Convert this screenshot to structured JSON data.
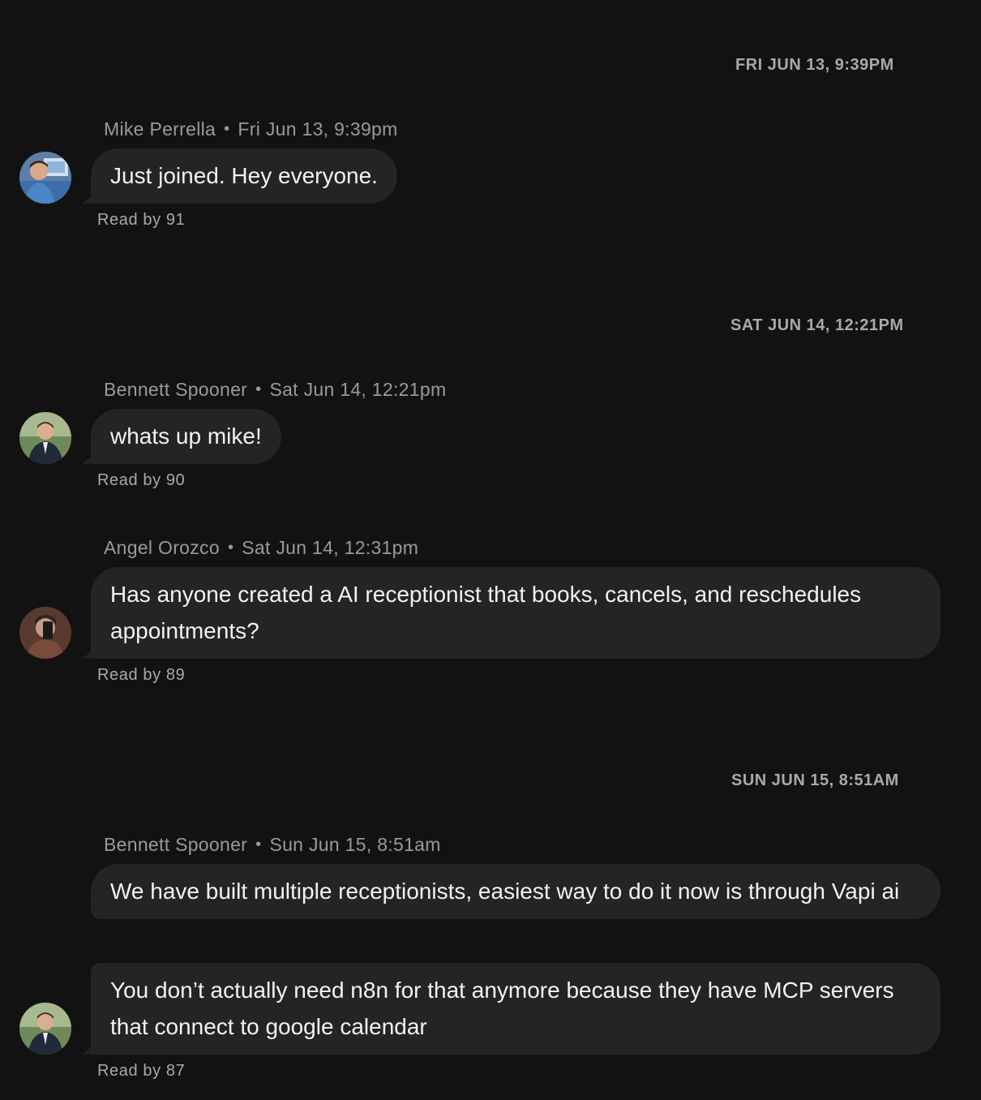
{
  "dividers": [
    "FRI JUN 13, 9:39PM",
    "SAT JUN 14, 12:21PM",
    "SUN JUN 15, 8:51AM"
  ],
  "messages": [
    {
      "author": "Mike Perrella",
      "time": "Fri Jun 13, 9:39pm",
      "bubbles": [
        "Just joined. Hey everyone."
      ],
      "read": "Read by 91",
      "avatar": "mike-perrella-avatar"
    },
    {
      "author": "Bennett Spooner",
      "time": "Sat Jun 14, 12:21pm",
      "bubbles": [
        "whats up mike!"
      ],
      "read": "Read by 90",
      "avatar": "bennett-spooner-avatar"
    },
    {
      "author": "Angel Orozco",
      "time": "Sat Jun 14, 12:31pm",
      "bubbles": [
        "Has anyone created a AI receptionist that books, cancels, and reschedules appointments?"
      ],
      "read": "Read by 89",
      "avatar": "angel-orozco-avatar"
    },
    {
      "author": "Bennett Spooner",
      "time": "Sun Jun 15, 8:51am",
      "bubbles": [
        "We have built multiple receptionists, easiest way to do it now is through Vapi ai",
        "You don’t actually need n8n for that anymore because they have MCP servers that connect to google calendar"
      ],
      "read": "Read by 87",
      "avatar": "bennett-spooner-avatar"
    }
  ],
  "colors": {
    "background": "#121212",
    "bubble": "#242424",
    "meta_text": "#9a9a9a",
    "message_text": "#f2f2f2"
  }
}
